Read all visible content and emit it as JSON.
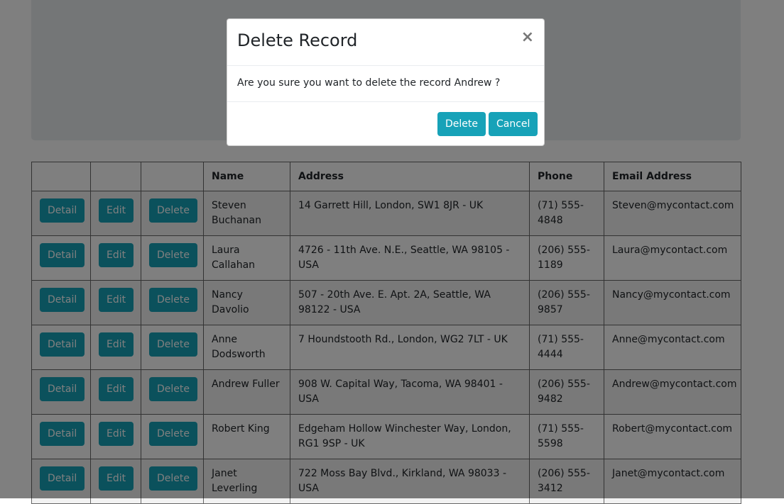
{
  "table": {
    "headers": [
      "",
      "",
      "",
      "Name",
      "Address",
      "Phone",
      "Email Address"
    ],
    "row_buttons": {
      "detail": "Detail",
      "edit": "Edit",
      "delete": "Delete"
    },
    "rows": [
      {
        "name": "Steven Buchanan",
        "address": "14 Garrett Hill, London, SW1 8JR - UK",
        "phone": "(71) 555-4848",
        "email": "Steven@mycontact.com"
      },
      {
        "name": "Laura Callahan",
        "address": "4726 - 11th Ave. N.E., Seattle, WA 98105 - USA",
        "phone": "(206) 555-1189",
        "email": "Laura@mycontact.com"
      },
      {
        "name": "Nancy Davolio",
        "address": "507 - 20th Ave. E. Apt. 2A, Seattle, WA 98122 - USA",
        "phone": "(206) 555-9857",
        "email": "Nancy@mycontact.com"
      },
      {
        "name": "Anne Dodsworth",
        "address": "7 Houndstooth Rd., London, WG2 7LT - UK",
        "phone": "(71) 555-4444",
        "email": "Anne@mycontact.com"
      },
      {
        "name": "Andrew Fuller",
        "address": "908 W. Capital Way, Tacoma, WA 98401 - USA",
        "phone": "(206) 555-9482",
        "email": "Andrew@mycontact.com"
      },
      {
        "name": "Robert King",
        "address": "Edgeham Hollow Winchester Way, London, RG1 9SP - UK",
        "phone": "(71) 555-5598",
        "email": "Robert@mycontact.com"
      },
      {
        "name": "Janet Leverling",
        "address": "722 Moss Bay Blvd., Kirkland, WA 98033 - USA",
        "phone": "(206) 555-3412",
        "email": "Janet@mycontact.com"
      }
    ]
  },
  "modal": {
    "title": "Delete Record",
    "close_glyph": "×",
    "message": "Are you sure you want to delete the record Andrew ?",
    "delete_label": "Delete",
    "cancel_label": "Cancel"
  },
  "colors": {
    "button": "#17a2b8",
    "overlay": "rgba(0,0,0,0.5)"
  }
}
